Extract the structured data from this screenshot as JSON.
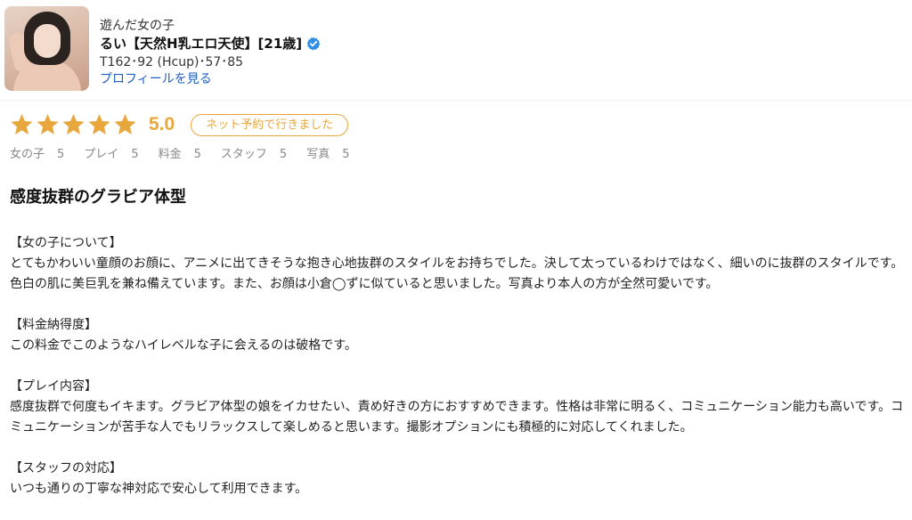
{
  "profile": {
    "section_label": "遊んだ女の子",
    "name": "るい【天然H乳エロ天使】[21歳]",
    "specs": "T162･92 (Hcup)･57･85",
    "profile_link": "プロフィールを見る"
  },
  "rating": {
    "stars": 5,
    "score": "5.0",
    "badge": "ネット予約で行きました",
    "star_color": "#e8a73d",
    "sub_ratings": [
      {
        "label": "女の子",
        "value": "5"
      },
      {
        "label": "プレイ",
        "value": "5"
      },
      {
        "label": "料金",
        "value": "5"
      },
      {
        "label": "スタッフ",
        "value": "5"
      },
      {
        "label": "写真",
        "value": "5"
      }
    ]
  },
  "review": {
    "title": "感度抜群のグラビア体型",
    "sections": [
      {
        "heading": "【女の子について】",
        "text": "とてもかわいい童顔のお顔に、アニメに出てきそうな抱き心地抜群のスタイルをお持ちでした。決して太っているわけではなく、細いのに抜群のスタイルです。色白の肌に美巨乳を兼ね備えています。また、お顔は小倉◯ずに似ていると思いました。写真より本人の方が全然可愛いです。"
      },
      {
        "heading": "【料金納得度】",
        "text": "この料金でこのようなハイレベルな子に会えるのは破格です。"
      },
      {
        "heading": "【プレイ内容】",
        "text": "感度抜群で何度もイキます。グラビア体型の娘をイカせたい、責め好きの方におすすめできます。性格は非常に明るく、コミュニケーション能力も高いです。コミュニケーションが苦手な人でもリラックスして楽しめると思います。撮影オプションにも積極的に対応してくれました。"
      },
      {
        "heading": "【スタッフの対応】",
        "text": "いつも通りの丁寧な神対応で安心して利用できます。"
      }
    ]
  },
  "colors": {
    "accent": "#e8a73d",
    "link": "#1f5fbf",
    "verified": "#2f8fe8"
  }
}
